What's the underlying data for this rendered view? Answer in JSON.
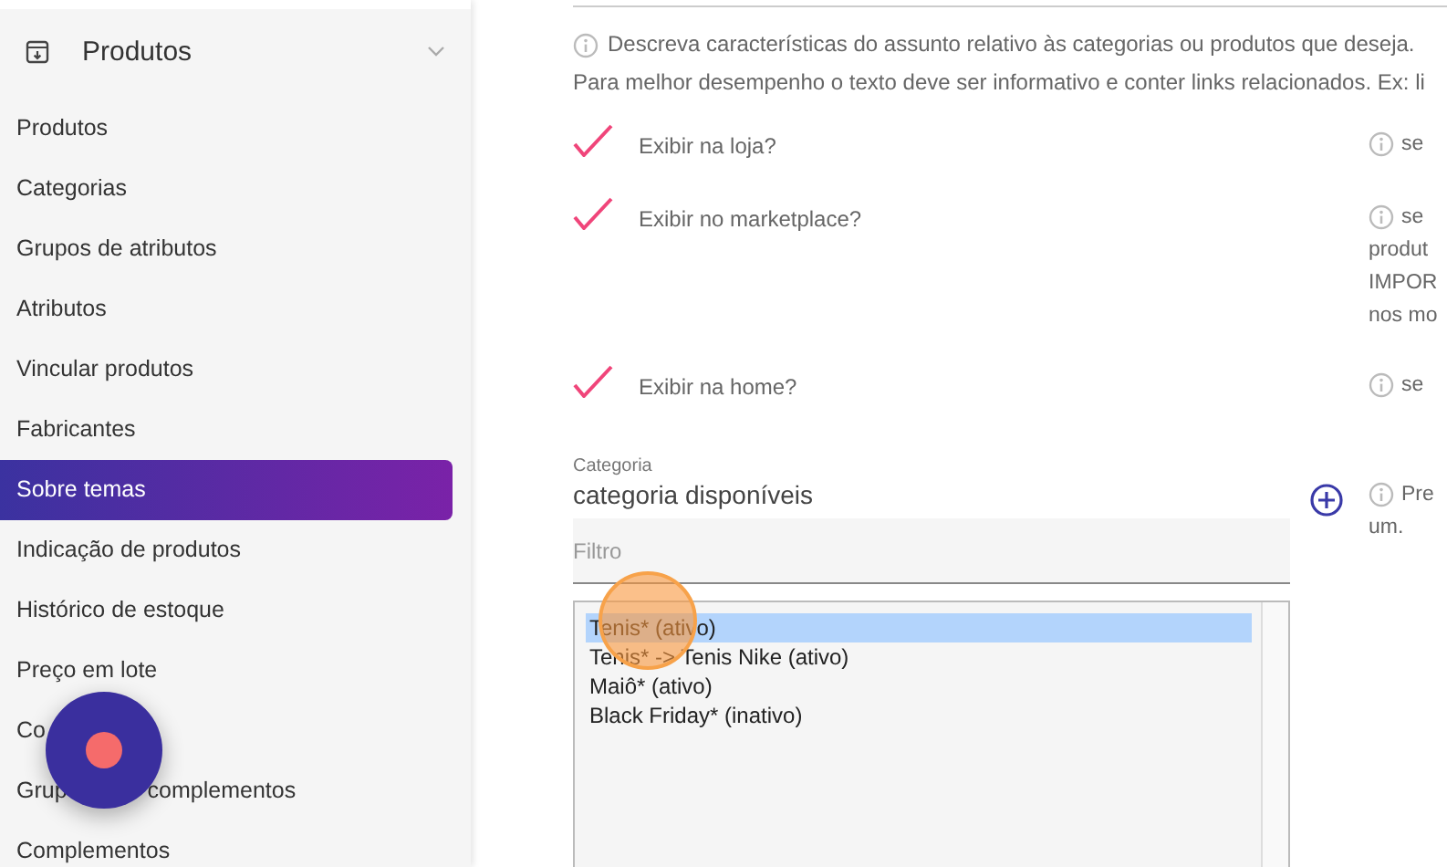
{
  "sidebar": {
    "section": {
      "title": "Produtos",
      "expanded": true
    },
    "items": [
      {
        "label": "Produtos",
        "selected": false
      },
      {
        "label": "Categorias",
        "selected": false
      },
      {
        "label": "Grupos de atributos",
        "selected": false
      },
      {
        "label": "Atributos",
        "selected": false
      },
      {
        "label": "Vincular produtos",
        "selected": false
      },
      {
        "label": "Fabricantes",
        "selected": false
      },
      {
        "label": "Sobre temas",
        "selected": true
      },
      {
        "label": "Indicação de produtos",
        "selected": false
      },
      {
        "label": "Histórico de estoque",
        "selected": false
      },
      {
        "label": "Preço em lote",
        "selected": false
      },
      {
        "label": "Co",
        "selected": false
      },
      {
        "label": "Grup",
        "label_after": "complementos",
        "selected": false
      },
      {
        "label": "Complementos",
        "selected": false
      }
    ]
  },
  "description": {
    "lines": [
      "Descreva características do assunto relativo às categorias ou produtos que deseja.",
      "Para melhor desempenho o texto deve ser informativo e conter links relacionados. Ex: li"
    ]
  },
  "options": [
    {
      "label": "Exibir na loja?",
      "checked": true,
      "hint_lines": [
        "se"
      ]
    },
    {
      "label": "Exibir no marketplace?",
      "checked": true,
      "hint_lines": [
        "se",
        "produt",
        "IMPOR",
        "nos mo"
      ]
    },
    {
      "label": "Exibir na home?",
      "checked": true,
      "hint_lines": [
        "se"
      ]
    }
  ],
  "category": {
    "label": "Categoria",
    "title": "categoria disponíveis",
    "filter": {
      "placeholder": "Filtro"
    },
    "options": [
      {
        "label": "Tenis* (ativo)",
        "selected": true
      },
      {
        "label": "Tenis* -> Tenis Nike (ativo)",
        "selected": false
      },
      {
        "label": "Maiô* (ativo)",
        "selected": false
      },
      {
        "label": "Black Friday* (inativo)",
        "selected": false
      }
    ],
    "hint_lines": [
      "Pre",
      "um."
    ]
  }
}
